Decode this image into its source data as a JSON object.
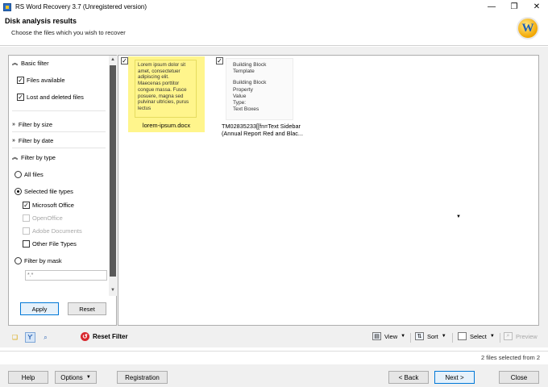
{
  "window": {
    "title": "RS Word Recovery 3.7 (Unregistered version)",
    "minimize_glyph": "—",
    "restore_glyph": "❐",
    "close_glyph": "✕"
  },
  "header": {
    "title": "Disk analysis results",
    "subtitle": "Choose the files which you wish to recover",
    "logo_letter": "W"
  },
  "filter": {
    "basic_filter": "Basic filter",
    "files_available": "Files available",
    "lost_and_deleted": "Lost and deleted files",
    "filter_by_size": "Filter by size",
    "filter_by_date": "Filter by date",
    "filter_by_type": "Filter by type",
    "all_files": "All files",
    "selected_file_types": "Selected file types",
    "microsoft_office": "Microsoft Office",
    "openoffice": "OpenOffice",
    "adobe_documents": "Adobe Documents",
    "other_file_types": "Other File Types",
    "filter_by_mask": "Filter by mask",
    "mask_value": "*.*",
    "apply": "Apply",
    "reset": "Reset"
  },
  "files": [
    {
      "name": "lorem-ipsum.docx",
      "preview": "Lorem ipsum dolor sit amet, consectetuer adipiscing elit. Maecenas porttitor congue massa. Fusce posuere, magna sed pulvinar ultricies, purus lectus",
      "checked": true
    },
    {
      "name": "TM02835233[[fn=Text Sidebar (Annual Report Red and Blac...",
      "preview_lines": [
        "Building Block",
        "Template",
        "Building Block",
        "Property",
        "Value",
        "Type:",
        "Text Boxes"
      ],
      "checked": true
    }
  ],
  "toolbar": {
    "reset_filter": "Reset Filter",
    "view": "View",
    "sort": "Sort",
    "select": "Select",
    "preview": "Preview"
  },
  "status": {
    "selection": "2 files selected from 2"
  },
  "buttons": {
    "help": "Help",
    "options": "Options",
    "registration": "Registration",
    "back": "< Back",
    "next": "Next >",
    "close": "Close"
  },
  "colors": {
    "highlight": "#fff58c",
    "accent": "#0078d7",
    "reset_icon": "#d8262c"
  }
}
